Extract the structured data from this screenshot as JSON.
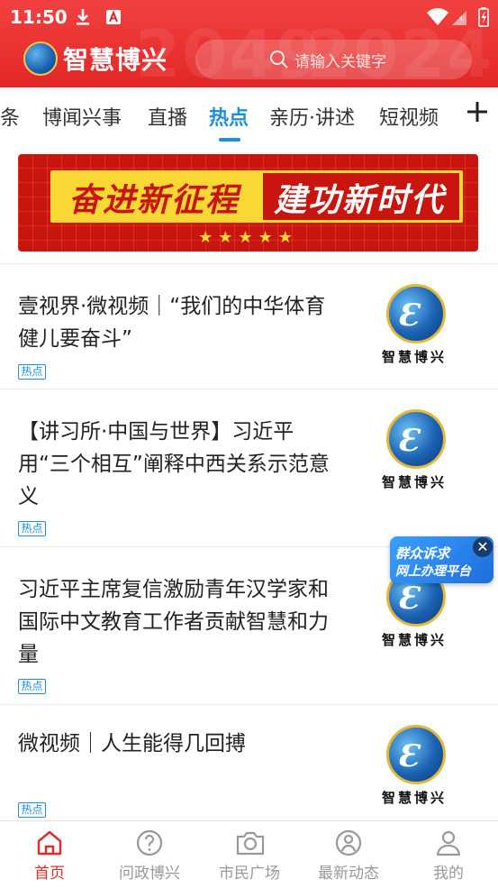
{
  "status_bar": {
    "time": "11:50"
  },
  "header": {
    "bg_text_left": "2049",
    "bg_text_right": "2024",
    "logo_text": "智慧博兴",
    "search_placeholder": "请输入关键字"
  },
  "tabs": [
    {
      "label": "条"
    },
    {
      "label": "博闻兴事"
    },
    {
      "label": "直播"
    },
    {
      "label": "热点",
      "active": true
    },
    {
      "label": "亲历·讲述"
    },
    {
      "label": "短视频"
    }
  ],
  "banner": {
    "left": "奋进新征程",
    "right": "建功新时代",
    "stars": "★★★★★"
  },
  "news": [
    {
      "title": "壹视界·微视频｜“我们的中华体育健儿要奋斗”",
      "tag": "热点",
      "thumb_text": "智慧博兴"
    },
    {
      "title": "【讲习所·中国与世界】习近平用“三个相互”阐释中西关系示范意义",
      "tag": "热点",
      "thumb_text": "智慧博兴"
    },
    {
      "title": "习近平主席复信激励青年汉学家和国际中文教育工作者贡献智慧和力量",
      "tag": "热点",
      "thumb_text": "智慧博兴"
    },
    {
      "title": "微视频｜人生能得几回搏",
      "tag": "热点",
      "thumb_text": "智慧博兴"
    }
  ],
  "float_badge": {
    "line1": "群众诉求",
    "line2": "网上办理平台"
  },
  "bottom_nav": [
    {
      "label": "首页",
      "icon": "home-icon",
      "active": true
    },
    {
      "label": "问政博兴",
      "icon": "question-icon"
    },
    {
      "label": "市民广场",
      "icon": "camera-icon"
    },
    {
      "label": "最新动态",
      "icon": "compass-icon"
    },
    {
      "label": "我的",
      "icon": "user-icon"
    }
  ],
  "colors": {
    "header_red": "#e32626",
    "accent_blue": "#1e8fd9",
    "nav_active": "#d9302b"
  }
}
